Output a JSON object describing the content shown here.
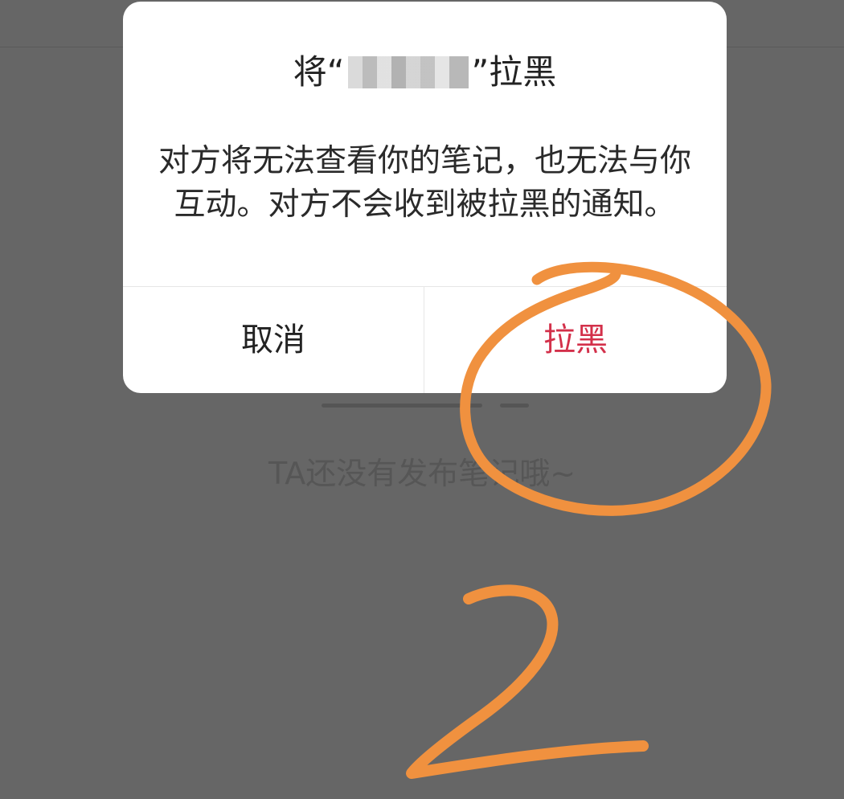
{
  "background_page": {
    "empty_message": "TA还没有发布笔记哦~"
  },
  "dialog": {
    "title_before": "将“",
    "title_after": "”拉黑",
    "body": "对方将无法查看你的笔记，也无法与你互动。对方不会收到被拉黑的通知。",
    "cancel_label": "取消",
    "confirm_label": "拉黑"
  },
  "annotation": {
    "step_number": "2",
    "color": "#F0913F"
  },
  "colors": {
    "overlay_background": "#666666",
    "dialog_background": "#FFFFFF",
    "confirm_text": "#D3304A",
    "primary_text": "#222222"
  }
}
